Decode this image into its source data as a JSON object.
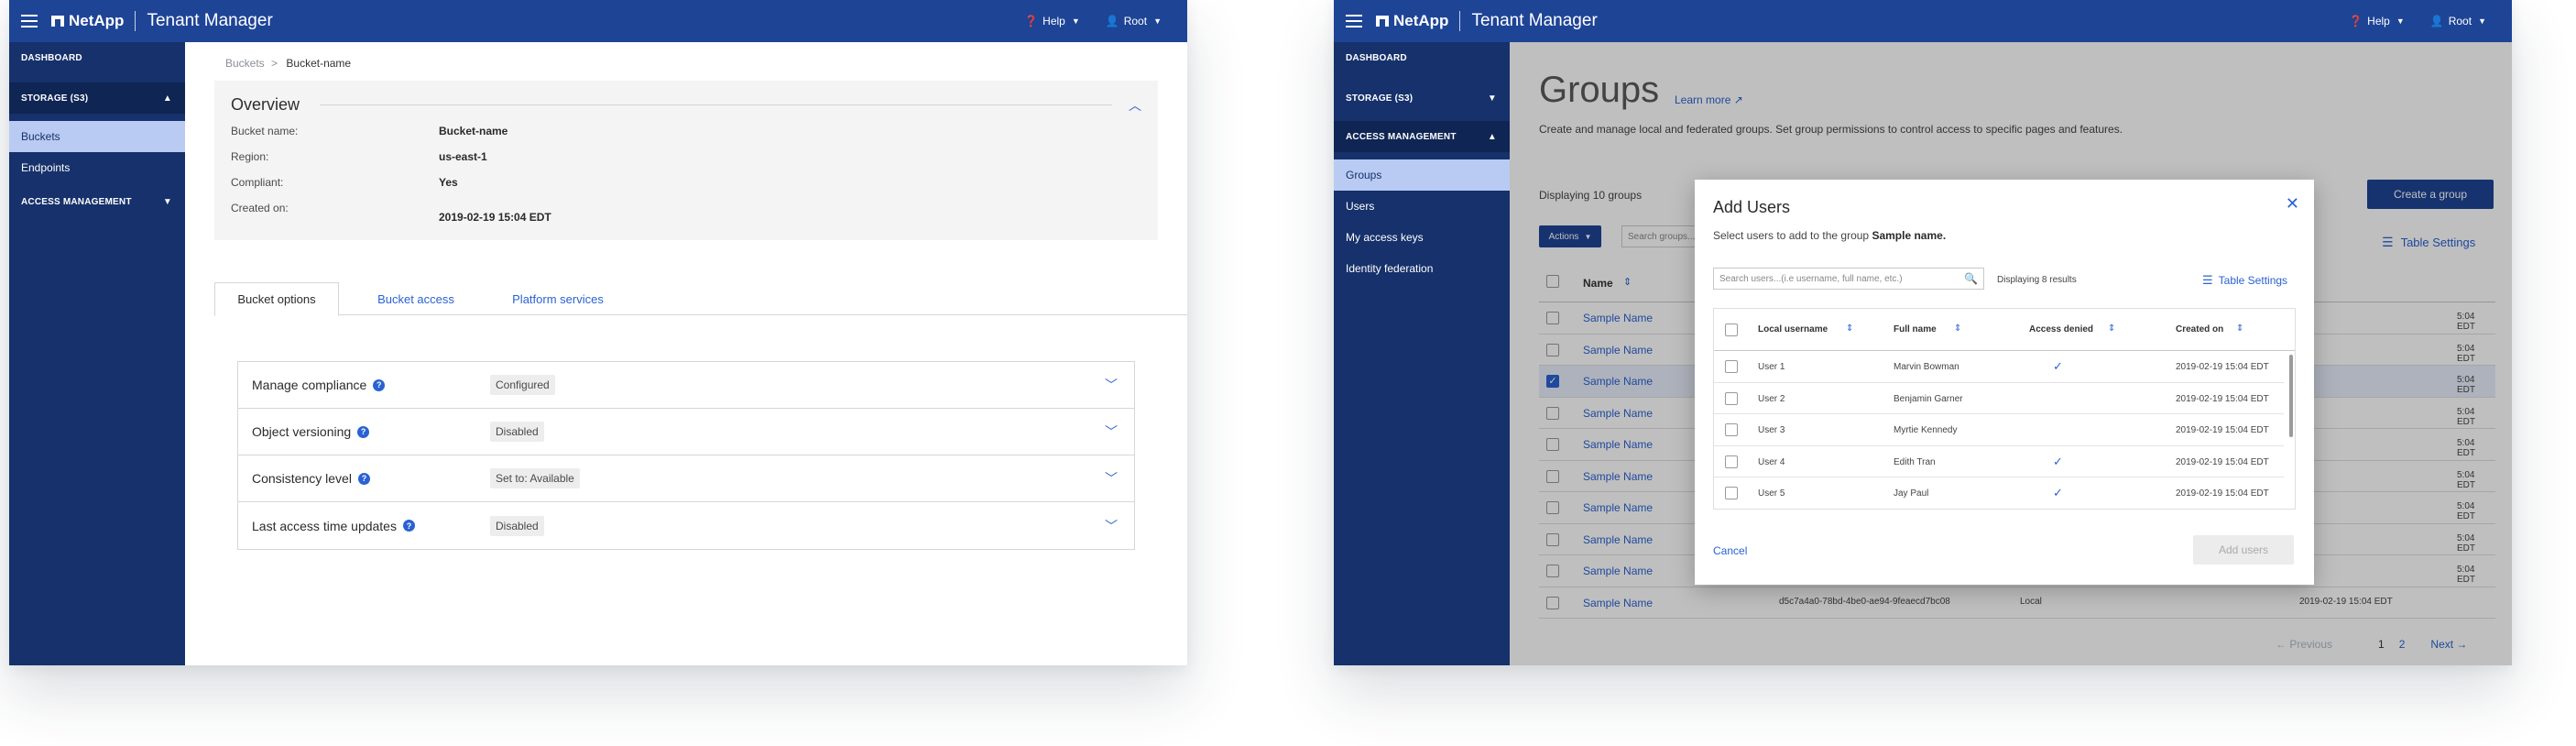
{
  "brand": "NetApp",
  "app_title": "Tenant Manager",
  "help_label": "Help",
  "user_label": "Root",
  "left": {
    "sidebar": {
      "dashboard": "DASHBOARD",
      "storage": "STORAGE (S3)",
      "buckets": "Buckets",
      "endpoints": "Endpoints",
      "access": "ACCESS MANAGEMENT"
    },
    "breadcrumb": {
      "parent": "Buckets",
      "sep": ">",
      "current": "Bucket-name"
    },
    "overview": {
      "title": "Overview",
      "rows": [
        {
          "label": "Bucket name:",
          "value": "Bucket-name"
        },
        {
          "label": "Region:",
          "value": "us-east-1"
        },
        {
          "label": "Compliant:",
          "value": "Yes"
        },
        {
          "label": "Created on:",
          "value": "2019-02-19 15:04 EDT"
        }
      ]
    },
    "tabs": [
      "Bucket options",
      "Bucket access",
      "Platform services"
    ],
    "options": [
      {
        "label": "Manage compliance",
        "status": "Configured"
      },
      {
        "label": "Object versioning",
        "status": "Disabled"
      },
      {
        "label": "Consistency level",
        "status": "Set to: Available"
      },
      {
        "label": "Last access time updates",
        "status": "Disabled"
      }
    ]
  },
  "right": {
    "sidebar": {
      "dashboard": "DASHBOARD",
      "storage": "STORAGE (S3)",
      "access": "ACCESS MANAGEMENT",
      "groups": "Groups",
      "users": "Users",
      "keys": "My access keys",
      "federation": "Identity federation"
    },
    "title": "Groups",
    "learn_more": "Learn more",
    "description": "Create and manage local and federated groups. Set group permissions to control access to specific pages and features.",
    "displaying": "Displaying 10 groups",
    "create_button": "Create a group",
    "actions_button": "Actions",
    "search_placeholder": "Search groups...",
    "table_settings": "Table Settings",
    "name_header": "Name",
    "group_name": "Sample Name",
    "date_short": "5:04 EDT",
    "last_row": {
      "uuid": "d5c7a4a0-78bd-4be0-ae94-9feaecd7bc08",
      "type": "Local",
      "date": "2019-02-19 15:04 EDT"
    },
    "pager": {
      "previous": "Previous",
      "page1": "1",
      "page2": "2",
      "next": "Next"
    },
    "modal": {
      "title": "Add Users",
      "subtitle_prefix": "Select users to add to the group",
      "group": "Sample name.",
      "search_placeholder": "Search users...(i.e username, full name, etc.)",
      "count": "Displaying 8 results",
      "table_settings": "Table Settings",
      "headers": [
        "Local username",
        "Full name",
        "Access denied",
        "Created on"
      ],
      "rows": [
        {
          "username": "User 1",
          "full_name": "Marvin Bowman",
          "denied": true,
          "created": "2019-02-19 15:04 EDT"
        },
        {
          "username": "User 2",
          "full_name": "Benjamin Garner",
          "denied": false,
          "created": "2019-02-19 15:04 EDT"
        },
        {
          "username": "User 3",
          "full_name": "Myrtie Kennedy",
          "denied": false,
          "created": "2019-02-19 15:04 EDT"
        },
        {
          "username": "User 4",
          "full_name": "Edith Tran",
          "denied": true,
          "created": "2019-02-19 15:04 EDT"
        },
        {
          "username": "User 5",
          "full_name": "Jay Paul",
          "denied": true,
          "created": "2019-02-19 15:04 EDT"
        }
      ],
      "cancel": "Cancel",
      "add": "Add users"
    }
  }
}
